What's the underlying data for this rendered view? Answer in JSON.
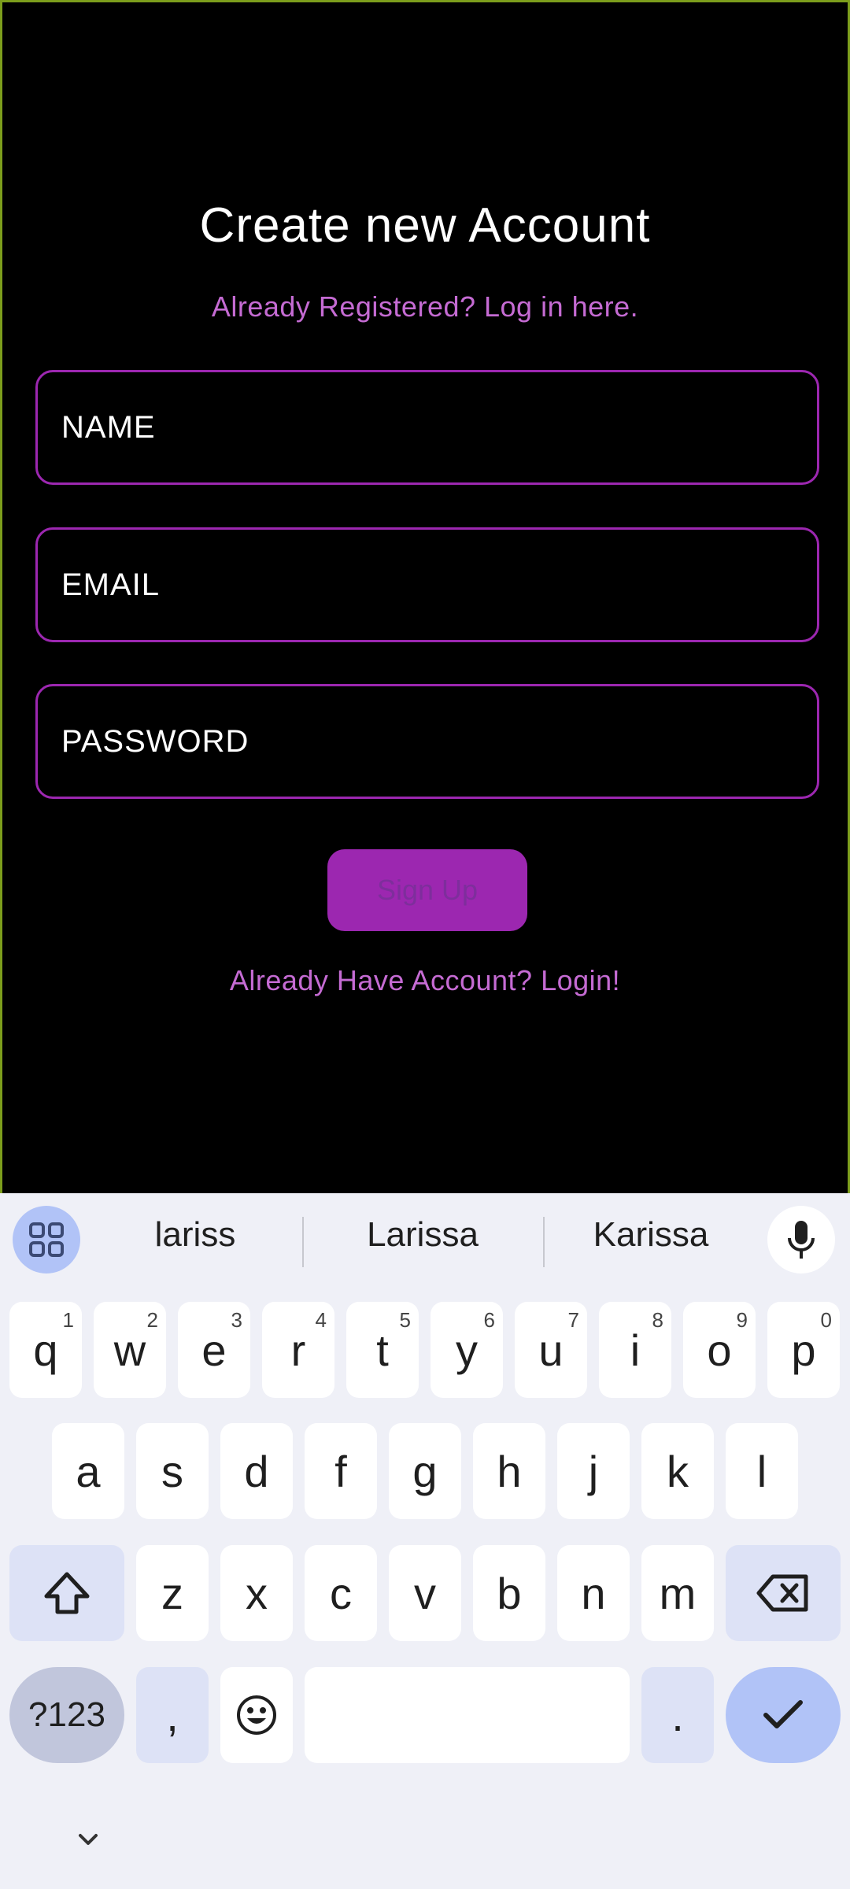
{
  "app": {
    "title": "Create new Account",
    "sub_link": "Already Registered? Log in here.",
    "fields": {
      "name_placeholder": "NAME",
      "email_placeholder": "EMAIL",
      "password_placeholder": "PASSWORD"
    },
    "signup_label": "Sign Up",
    "login_link": "Already Have Account? Login!"
  },
  "keyboard": {
    "suggestions": [
      "lariss",
      "Larissa",
      "Karissa"
    ],
    "row1": [
      {
        "k": "q",
        "h": "1"
      },
      {
        "k": "w",
        "h": "2"
      },
      {
        "k": "e",
        "h": "3"
      },
      {
        "k": "r",
        "h": "4"
      },
      {
        "k": "t",
        "h": "5"
      },
      {
        "k": "y",
        "h": "6"
      },
      {
        "k": "u",
        "h": "7"
      },
      {
        "k": "i",
        "h": "8"
      },
      {
        "k": "o",
        "h": "9"
      },
      {
        "k": "p",
        "h": "0"
      }
    ],
    "row2": [
      "a",
      "s",
      "d",
      "f",
      "g",
      "h",
      "j",
      "k",
      "l"
    ],
    "row3": [
      "z",
      "x",
      "c",
      "v",
      "b",
      "n",
      "m"
    ],
    "symbols_label": "?123",
    "comma_label": ",",
    "period_label": ".",
    "icons": [
      "apps-grid-icon",
      "mic-icon",
      "shift-icon",
      "backspace-icon",
      "emoji-icon",
      "check-icon",
      "chevron-down-icon"
    ]
  },
  "colors": {
    "accent": "#9c27b0",
    "link": "#c56bd3",
    "keyboard_bg": "#eff0f7"
  }
}
